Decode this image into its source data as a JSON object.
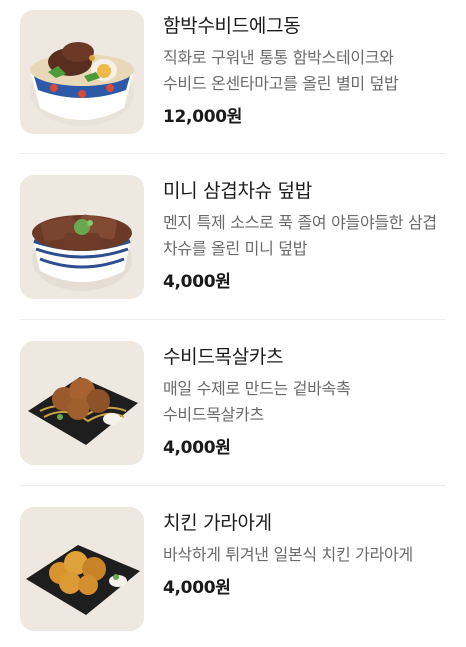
{
  "menu": {
    "items": [
      {
        "name": "함박수비드에그동",
        "description": "직화로 구워낸 통통 함박스테이크와 수비드 온센타마고를 올린 별미 덮밥",
        "price": "12,000원",
        "image": "hamburg-steak-egg-rice-bowl"
      },
      {
        "name": "미니 삼겹차슈 덮밥",
        "description": "멘지 특제 소스로 푹 졸여 야들야들한 삼겹 차슈를 올린 미니 덮밥",
        "price": "4,000원",
        "image": "pork-belly-chashu-rice-bowl"
      },
      {
        "name": "수비드목살카츠",
        "description": "매일 수제로 만드는 겉바속촉 수비드목살카츠",
        "price": "4,000원",
        "image": "fried-pork-katsu-plate"
      },
      {
        "name": "치킨 가라아게",
        "description": "바삭하게 튀겨낸 일본식 치킨 가라아게",
        "price": "4,000원",
        "image": "fried-chicken-karaage-plate"
      }
    ]
  },
  "colors": {
    "text_primary": "#1a1a1a",
    "text_secondary": "#6b6b6b",
    "divider": "#eeeeee"
  }
}
